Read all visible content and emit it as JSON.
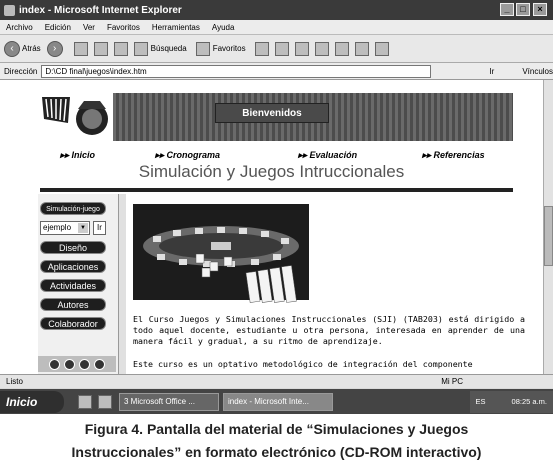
{
  "window": {
    "title": "index - Microsoft Internet Explorer"
  },
  "menu": [
    "Archivo",
    "Edición",
    "Ver",
    "Favoritos",
    "Herramientas",
    "Ayuda"
  ],
  "toolbar": {
    "back_label": "Atrás",
    "search_label": "Búsqueda",
    "favorites_label": "Favoritos"
  },
  "address": {
    "label": "Dirección",
    "value": "D:\\CD final\\juegos\\index.htm",
    "go_label": "Ir",
    "links_label": "Vínculos"
  },
  "banner": {
    "welcome": "Bienvenidos"
  },
  "nav": [
    "Inicio",
    "Cronograma",
    "Evaluación",
    "Referencias"
  ],
  "site": {
    "title": "Simulación y Juegos Intruccionales"
  },
  "sidebar": {
    "top_label": "Simulación-juego",
    "select_value": "ejemplo",
    "select_go": "Ir",
    "items": [
      "Diseño",
      "Aplicaciones",
      "Actividades",
      "Autores",
      "Colaborador"
    ]
  },
  "content": {
    "paragraph1": "El Curso Juegos y Simulaciones Instruccionales (SJI) (TAB203) está dirigido a todo aquel docente, estudiante u otra persona, interesada en aprender de una manera fácil y gradual, a su ritmo de aprendizaje.",
    "paragraph2": "Este curso es un optativo metodológico de integración del componente"
  },
  "status": {
    "text": "Listo",
    "zone": "Mi PC"
  },
  "taskbar": {
    "start": "Inicio",
    "task1": "3 Microsoft Office ...",
    "task2": "index - Microsoft Inte...",
    "lang": "ES",
    "time": "08:25 a.m."
  },
  "caption": {
    "line1": "Figura 4. Pantalla del material de “Simulaciones y Juegos",
    "line2": "Instruccionales” en formato  electrónico (CD-ROM interactivo)"
  }
}
